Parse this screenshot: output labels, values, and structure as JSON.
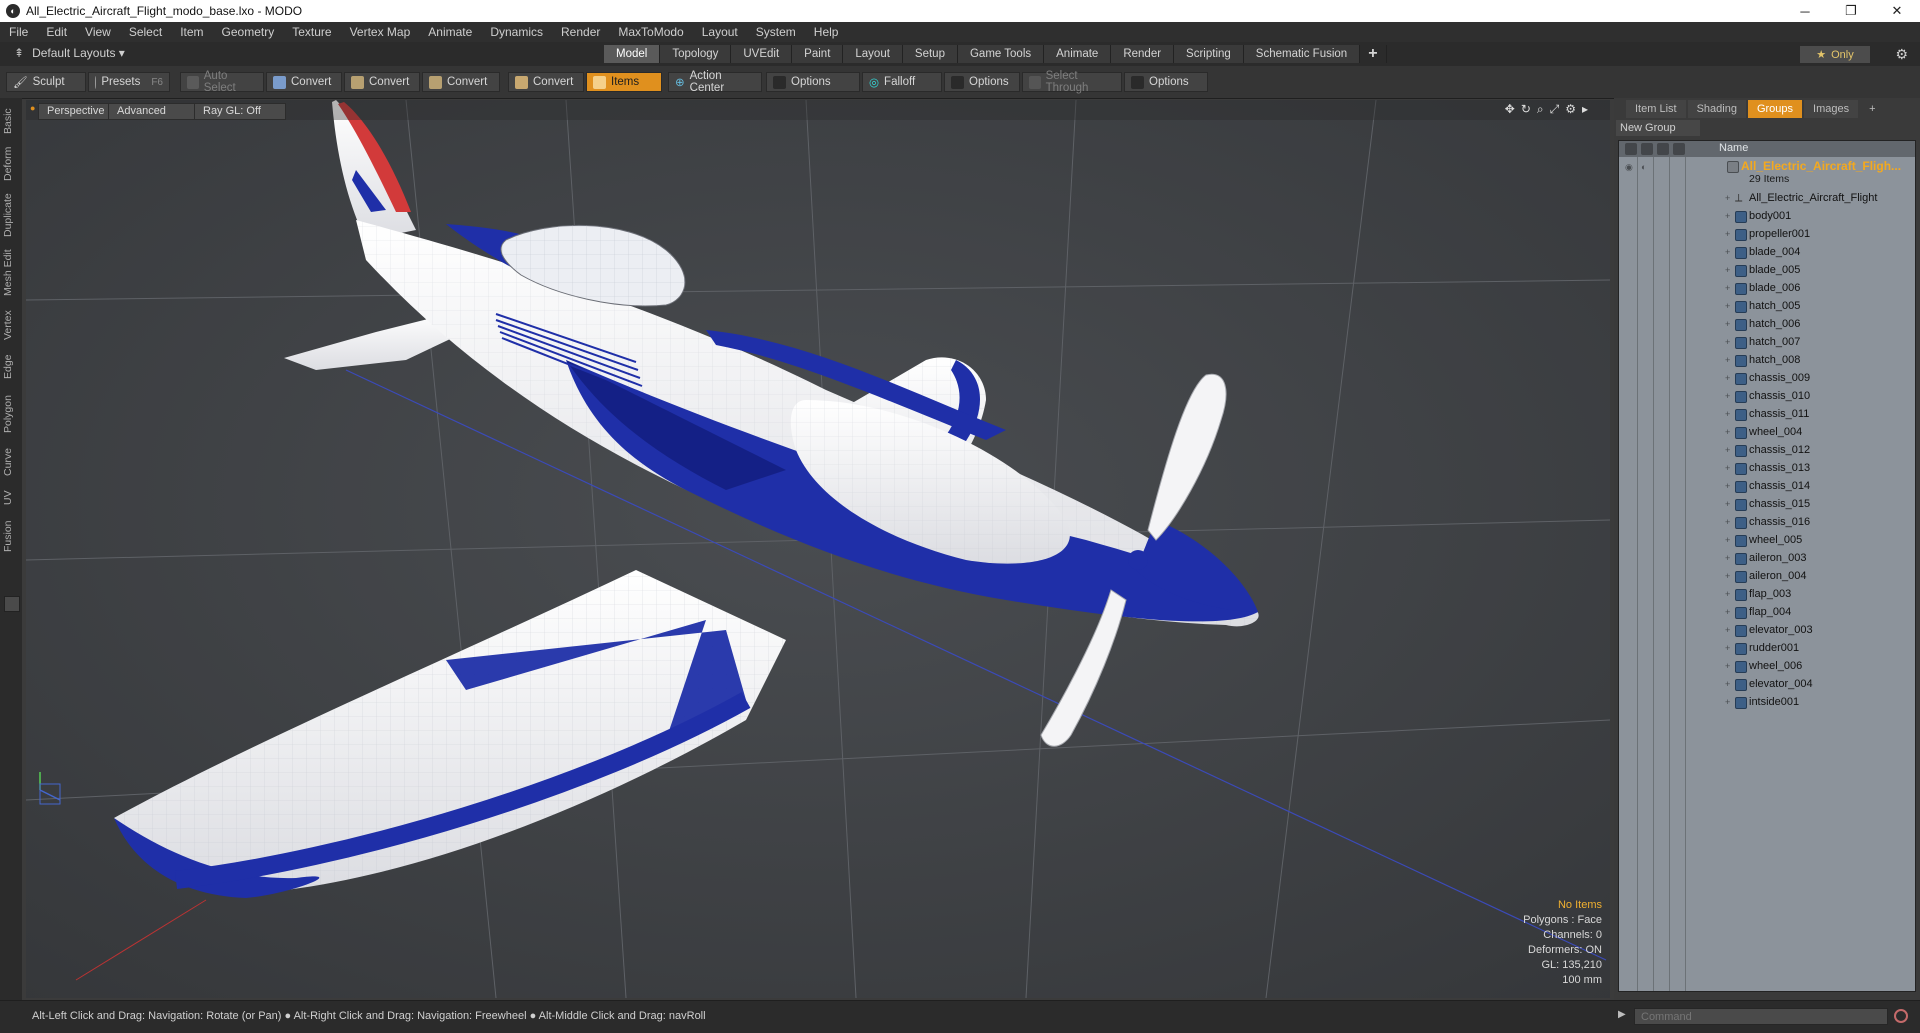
{
  "window": {
    "title": "All_Electric_Aircraft_Flight_modo_base.lxo - MODO",
    "app_icon": "modo-logo-icon",
    "controls": [
      "─",
      "❐",
      "✕"
    ]
  },
  "menu": [
    "File",
    "Edit",
    "View",
    "Select",
    "Item",
    "Geometry",
    "Texture",
    "Vertex Map",
    "Animate",
    "Dynamics",
    "Render",
    "MaxToModo",
    "Layout",
    "System",
    "Help"
  ],
  "layoutbar": {
    "layout_selector": "Default Layouts ▾",
    "tabs": [
      "Model",
      "Topology",
      "UVEdit",
      "Paint",
      "Layout",
      "Setup",
      "Game Tools",
      "Animate",
      "Render",
      "Scripting",
      "Schematic Fusion"
    ],
    "active_tab": "Model",
    "add_tab": "+",
    "only_button": "Only",
    "only_icon": "★"
  },
  "toolbar": {
    "sculpt": "Sculpt",
    "presets": "Presets",
    "presets_key": "F6",
    "auto_select": "Auto Select",
    "convert1": "Convert",
    "convert2": "Convert",
    "convert3": "Convert",
    "convert4": "Convert",
    "items": "Items",
    "action_center": "Action Center",
    "options1": "Options",
    "falloff": "Falloff",
    "options2": "Options",
    "select_through": "Select Through",
    "options3": "Options"
  },
  "left_tabs": [
    "Basic",
    "Deform",
    "Duplicate",
    "Mesh Edit",
    "Vertex",
    "Edge",
    "Polygon",
    "Curve",
    "UV",
    "Fusion"
  ],
  "viewport": {
    "view_mode": "Perspective",
    "shading": "Advanced",
    "raygl": "Ray GL: Off",
    "info": {
      "selection": "No Items",
      "polygons": "Polygons : Face",
      "channels": "Channels: 0",
      "deformers": "Deformers: ON",
      "gl": "GL: 135,210",
      "scale": "100 mm"
    },
    "colors": {
      "fuselage": "#f3f3f5",
      "stripe": "#1f2fa8",
      "stripe_dark": "#0d1870",
      "red": "#d23a3a",
      "background": "#3f4144"
    }
  },
  "right_panel": {
    "tabs": [
      "Item List",
      "Shading",
      "Groups",
      "Images",
      "+"
    ],
    "active_tab": "Groups",
    "new_group": "New Group",
    "name_header": "Name",
    "group_name": "All_Electric_Aircraft_Fligh...",
    "group_count": "29 Items",
    "items": [
      "All_Electric_Aircraft_Flight",
      "body001",
      "propeller001",
      "blade_004",
      "blade_005",
      "blade_006",
      "hatch_005",
      "hatch_006",
      "hatch_007",
      "hatch_008",
      "chassis_009",
      "chassis_010",
      "chassis_011",
      "wheel_004",
      "chassis_012",
      "chassis_013",
      "chassis_014",
      "chassis_015",
      "chassis_016",
      "wheel_005",
      "aileron_003",
      "aileron_004",
      "flap_003",
      "flap_004",
      "elevator_003",
      "rudder001",
      "wheel_006",
      "elevator_004",
      "intside001"
    ]
  },
  "statusbar": {
    "hint": "Alt-Left Click and Drag: Navigation: Rotate (or Pan) ● Alt-Right Click and Drag: Navigation: Freewheel ● Alt-Middle Click and Drag: navRoll",
    "command_placeholder": "Command"
  }
}
